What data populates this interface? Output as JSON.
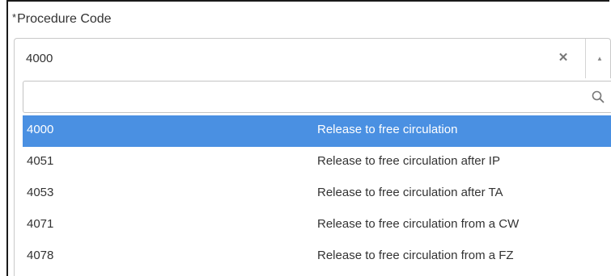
{
  "field": {
    "required_marker": "*",
    "label": "Procedure Code"
  },
  "select": {
    "value": "4000",
    "clear_glyph": "✕",
    "toggle_glyph": "▲"
  },
  "dropdown": {
    "search_placeholder": "",
    "options": [
      {
        "code": "4000",
        "description": "Release to free circulation",
        "selected": true
      },
      {
        "code": "4051",
        "description": "Release to free circulation after IP",
        "selected": false
      },
      {
        "code": "4053",
        "description": "Release to free circulation after TA",
        "selected": false
      },
      {
        "code": "4071",
        "description": "Release to free circulation from a CW",
        "selected": false
      },
      {
        "code": "4078",
        "description": "Release to free circulation from a FZ",
        "selected": false
      }
    ]
  },
  "colors": {
    "selected_bg": "#4a90e2",
    "selected_text": "#ffffff",
    "border": "#c9c9c9"
  },
  "icons": {
    "clear": "close-icon",
    "toggle": "chevron-up-icon",
    "search": "search-icon"
  }
}
